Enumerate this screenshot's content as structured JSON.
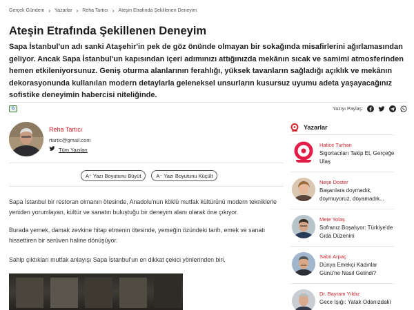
{
  "breadcrumb": {
    "items": [
      "Gerçek Gündem",
      "Yazarlar",
      "Reha Tartıcı",
      "Ateşin Etrafında Şekillenen Deneyim"
    ]
  },
  "article": {
    "title": "Ateşin Etrafında Şekillenen Deneyim",
    "lead": "Sapa İstanbul'un adı sanki Ataşehir'in pek de göz önünde olmayan bir sokağında misafirlerini ağırlamasından geliyor. Ancak Sapa İstanbul'un kapısından içeri adımınızı attığınızda mekânın sıcak ve samimi atmosferinden hemen etkileniyorsunuz. Geniş oturma alanlarının ferahlığı, yüksek tavanların sağladığı açıklık ve mekânın dekorasyonunda kullanılan modern detaylarla geleneksel unsurların kusursuz uyumu adeta yaşayacağınız sofistike deneyimin habercisi niteliğinde.",
    "paragraphs": [
      "Sapa İstanbul bir restoran olmanın ötesinde, Anadolu'nun köklü mutfak kültürünü modern tekniklerle yeniden yorumlayan, kültür ve sanatın buluştuğu bir deneyim alanı olarak öne çıkıyor.",
      "Burada yemek, damak zevkine hitap etmenin ötesinde, yemeğin özündeki tarih, emek ve sanatı hissettiren bir serüven haline dönüşüyor.",
      "Sahip çıktıkları mutfak anlayışı Sapa İstanbul'un en dikkat çekici yönlerinden biri."
    ]
  },
  "share": {
    "label": "Yazıyı Paylaş:",
    "icons": [
      "facebook-icon",
      "twitter-icon",
      "telegram-icon",
      "whatsapp-icon"
    ]
  },
  "author": {
    "name": "Reha Tartıcı",
    "email": "rtartic@gmail.com",
    "all_posts_label": "Tüm Yazıları"
  },
  "font_controls": {
    "increase_label": "A⁺ Yazı Boyutunu Büyüt",
    "decrease_label": "A⁻ Yazı Boyutunu Küçült"
  },
  "google_badge": "G",
  "sidebar": {
    "title": "Yazarlar",
    "items": [
      {
        "name": "Hatice Turhan",
        "title": "Sigortacıları Takip Et, Gerçeğe Ulaş"
      },
      {
        "name": "Neşe Doster",
        "title": "Başarılara doymadık, doymuyoruz, doyamadık..."
      },
      {
        "name": "Mete Yolaş",
        "title": "Sofranız Boşalıyor: Türkiye'de Gıda Düzenini"
      },
      {
        "name": "Sabri Arpaç",
        "title": "Dünya Emekçi Kadınlar Günü'ne Nasıl Gelindi?"
      },
      {
        "name": "Dr. Bayram Yıldız",
        "title": "Gece Işığı: Yatak Odanızdaki"
      }
    ]
  },
  "colors": {
    "accent": "#d2232a",
    "text": "#222222",
    "border": "#e5e5e5"
  }
}
